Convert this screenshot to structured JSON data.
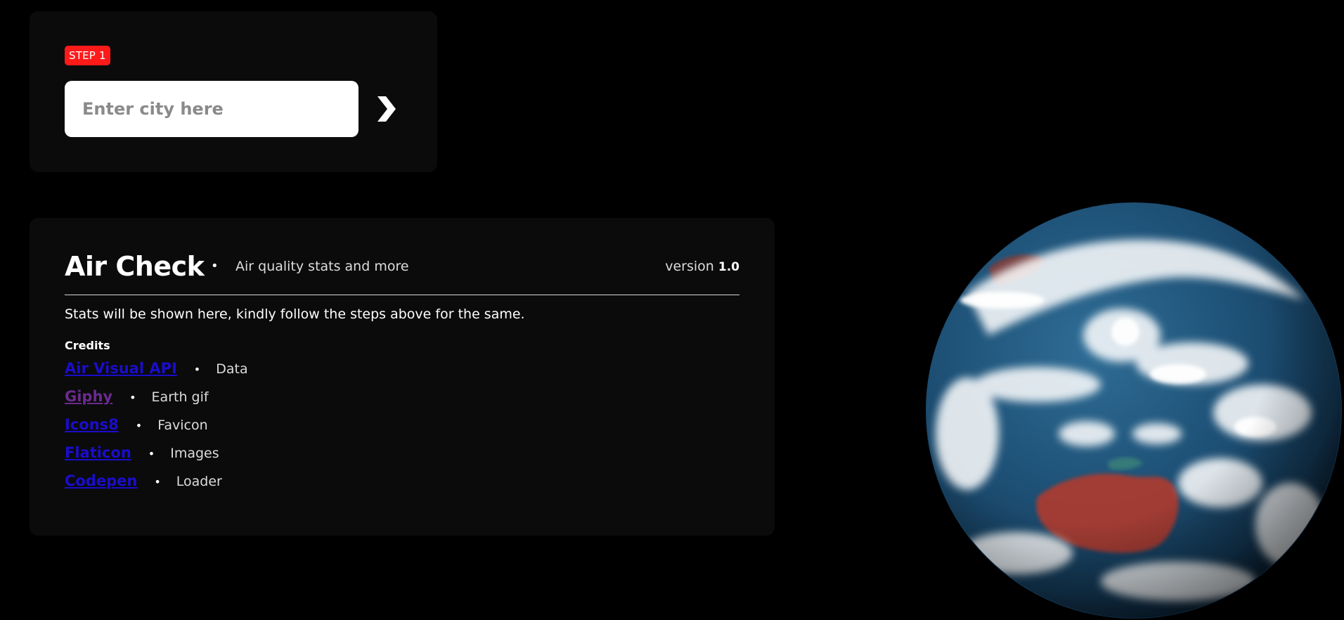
{
  "step_card": {
    "badge": "STEP 1",
    "input_placeholder": "Enter city here",
    "submit_icon": "chevron-right-icon"
  },
  "info_card": {
    "title": "Air Check",
    "bullet": "•",
    "tagline": "Air quality stats and more",
    "version_label": "version",
    "version_number": "1.0",
    "stats_message": "Stats will be shown here, kindly follow the steps above for the same.",
    "credits_title": "Credits",
    "credits": [
      {
        "name": "Air Visual API",
        "desc": "Data"
      },
      {
        "name": "Giphy",
        "desc": "Earth gif"
      },
      {
        "name": "Icons8",
        "desc": "Favicon"
      },
      {
        "name": "Flaticon",
        "desc": "Images"
      },
      {
        "name": "Codepen",
        "desc": "Loader"
      }
    ]
  },
  "colors": {
    "background": "#000000",
    "card": "#0b0b0b",
    "badge": "#ff1a1a",
    "link": "#1a0dcc",
    "link_visited": "#6b2a8f"
  },
  "earth_image": "earth-globe"
}
